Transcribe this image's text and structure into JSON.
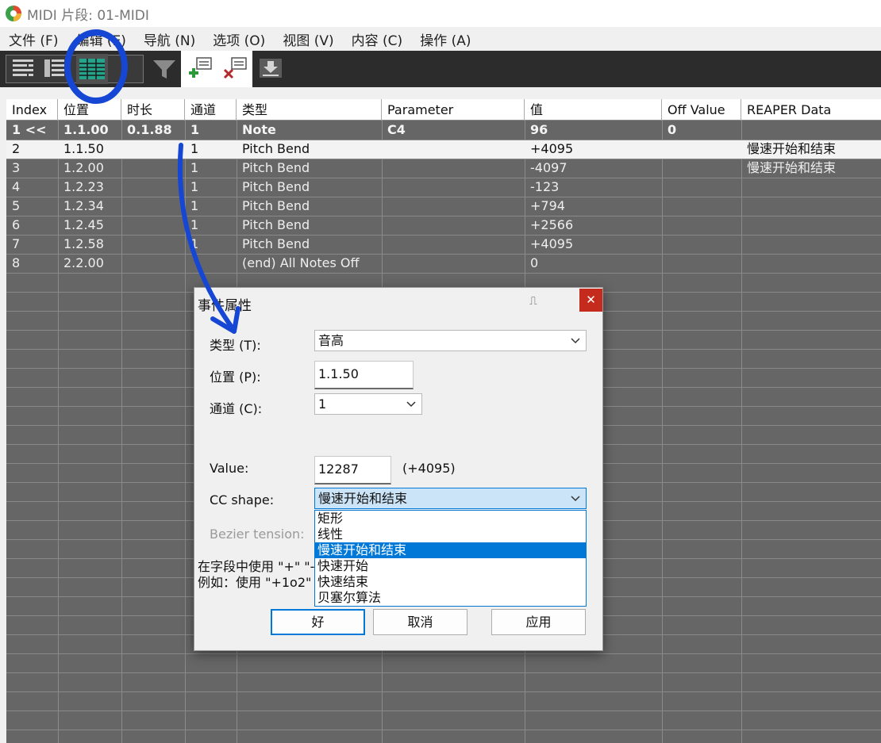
{
  "window": {
    "title": "MIDI 片段: 01-MIDI"
  },
  "menu": [
    "文件 (F)",
    "编辑 (E)",
    "导航 (N)",
    "选项 (O)",
    "视图 (V)",
    "内容 (C)",
    "操作 (A)"
  ],
  "colors": {
    "accent": "#0078d7",
    "annotation": "#1646d4",
    "list_bg": "#666666",
    "close": "#c42b1c"
  },
  "columns": [
    "Index",
    "位置",
    "时长",
    "通道",
    "类型",
    "Parameter",
    "值",
    "Off Value",
    "REAPER Data"
  ],
  "rows": [
    [
      "1 <<",
      "1.1.00",
      "0.1.88",
      "1",
      "Note",
      "C4",
      "96",
      "0",
      ""
    ],
    [
      "2",
      "1.1.50",
      "",
      "1",
      "Pitch Bend",
      "",
      "+4095",
      "",
      "慢速开始和结束"
    ],
    [
      "3",
      "1.2.00",
      "",
      "1",
      "Pitch Bend",
      "",
      "-4097",
      "",
      "慢速开始和结束"
    ],
    [
      "4",
      "1.2.23",
      "",
      "1",
      "Pitch Bend",
      "",
      "-123",
      "",
      ""
    ],
    [
      "5",
      "1.2.34",
      "",
      "1",
      "Pitch Bend",
      "",
      "+794",
      "",
      ""
    ],
    [
      "6",
      "1.2.45",
      "",
      "1",
      "Pitch Bend",
      "",
      "+2566",
      "",
      ""
    ],
    [
      "7",
      "1.2.58",
      "",
      "1",
      "Pitch Bend",
      "",
      "+4095",
      "",
      ""
    ],
    [
      "8",
      "2.2.00",
      "",
      "",
      "(end) All Notes Off",
      "",
      "0",
      "",
      ""
    ]
  ],
  "dialog": {
    "title": "事件属性",
    "pin": "⎍",
    "close": "✕",
    "type_label": "类型 (T):",
    "type_value": "音高",
    "position_label": "位置 (P):",
    "position_value": "1.1.50",
    "channel_label": "通道 (C):",
    "channel_value": "1",
    "value_label": "Value:",
    "value_value": "12287",
    "value_hint": "(+4095)",
    "cc_shape_label": "CC shape:",
    "cc_shape_value": "慢速开始和结束",
    "cc_shape_options": [
      "矩形",
      "线性",
      "慢速开始和结束",
      "快速开始",
      "快速结束",
      "贝塞尔算法"
    ],
    "bezier_label": "Bezier tension:",
    "help_line1": "在字段中使用 \"+\" \"-\"",
    "help_line2": "例如：使用 \"+1o2\" 来",
    "ok": "好",
    "cancel": "取消",
    "apply": "应用"
  }
}
